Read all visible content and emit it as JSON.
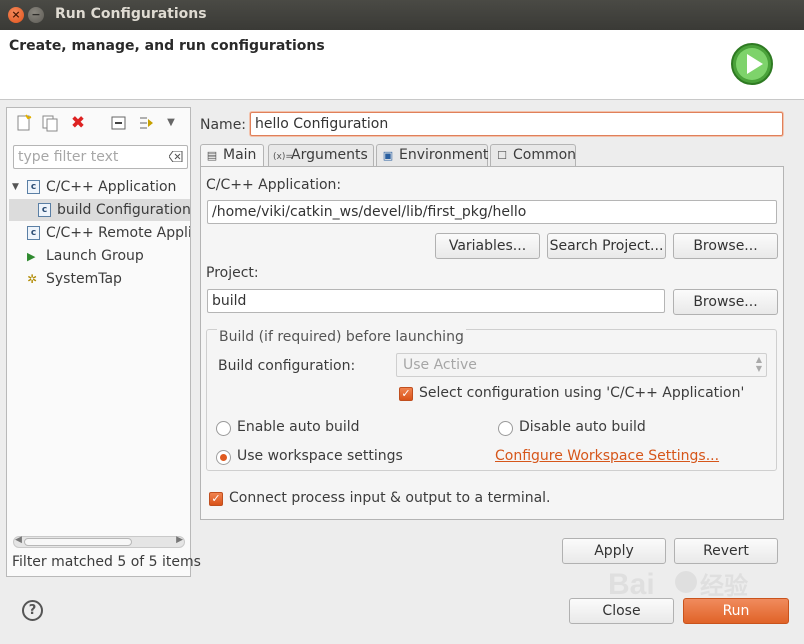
{
  "window": {
    "title": "Run Configurations"
  },
  "header": {
    "title": "Create, manage, and run configurations"
  },
  "left": {
    "filter_placeholder": "type filter text",
    "tree": [
      {
        "label": "C/C++ Application",
        "icon": "c-app-icon",
        "expanded": true
      },
      {
        "label": "build Configuration",
        "icon": "c-config-icon",
        "selected": true
      },
      {
        "label": "C/C++ Remote Applica",
        "icon": "c-remote-icon"
      },
      {
        "label": "Launch Group",
        "icon": "launch-group-icon"
      },
      {
        "label": "SystemTap",
        "icon": "systemtap-icon"
      }
    ],
    "status": "Filter matched 5 of 5 items"
  },
  "config": {
    "name_label": "Name:",
    "name_value": "hello Configuration",
    "tabs": [
      "Main",
      "Arguments",
      "Environment",
      "Common"
    ],
    "app_label": "C/C++ Application:",
    "app_value": "/home/viki/catkin_ws/devel/lib/first_pkg/hello",
    "variables_btn": "Variables...",
    "search_project_btn": "Search Project...",
    "browse_btn": "Browse...",
    "project_label": "Project:",
    "project_value": "build",
    "browse_btn2": "Browse...",
    "build_group_title": "Build (if required) before launching",
    "build_config_label": "Build configuration:",
    "build_config_value": "Use Active",
    "select_config_label": "Select configuration using 'C/C++ Application'",
    "enable_auto_build": "Enable auto build",
    "disable_auto_build": "Disable auto build",
    "use_workspace": "Use workspace settings",
    "configure_workspace_link": "Configure Workspace Settings...",
    "connect_terminal": "Connect process input & output to a terminal.",
    "apply_btn": "Apply",
    "revert_btn": "Revert"
  },
  "footer": {
    "close_btn": "Close",
    "run_btn": "Run"
  },
  "colors": {
    "accent": "#e05a1f",
    "link": "#d6561a"
  }
}
